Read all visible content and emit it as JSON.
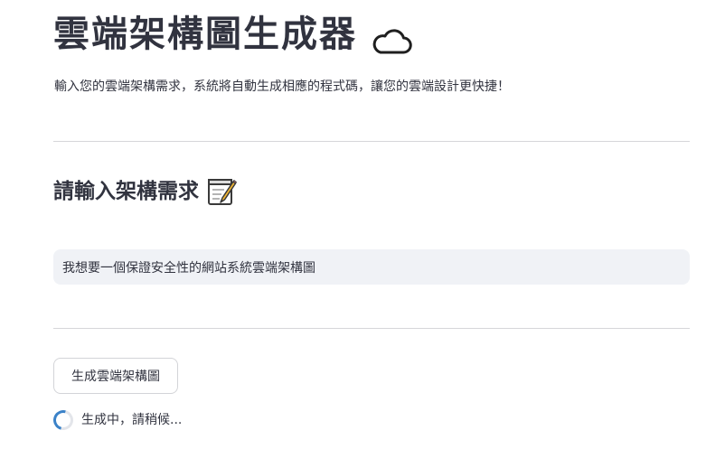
{
  "header": {
    "title": "雲端架構圖生成器",
    "title_icon": "cloud-icon",
    "subtitle": "輸入您的雲端架構需求，系統將自動生成相應的程式碼，讓您的雲端設計更快捷！"
  },
  "section": {
    "heading": "請輸入架構需求",
    "heading_icon": "memo-icon"
  },
  "input": {
    "value": "我想要一個保證安全性的網站系統雲端架構圖"
  },
  "actions": {
    "generate_label": "生成雲端架構圖"
  },
  "status": {
    "text": "生成中，請稍候...",
    "icon": "spinner-icon"
  },
  "colors": {
    "text": "#31333f",
    "input_background": "#f0f2f6",
    "divider": "#d6d6d9",
    "spinner_accent": "#3b82c8"
  }
}
